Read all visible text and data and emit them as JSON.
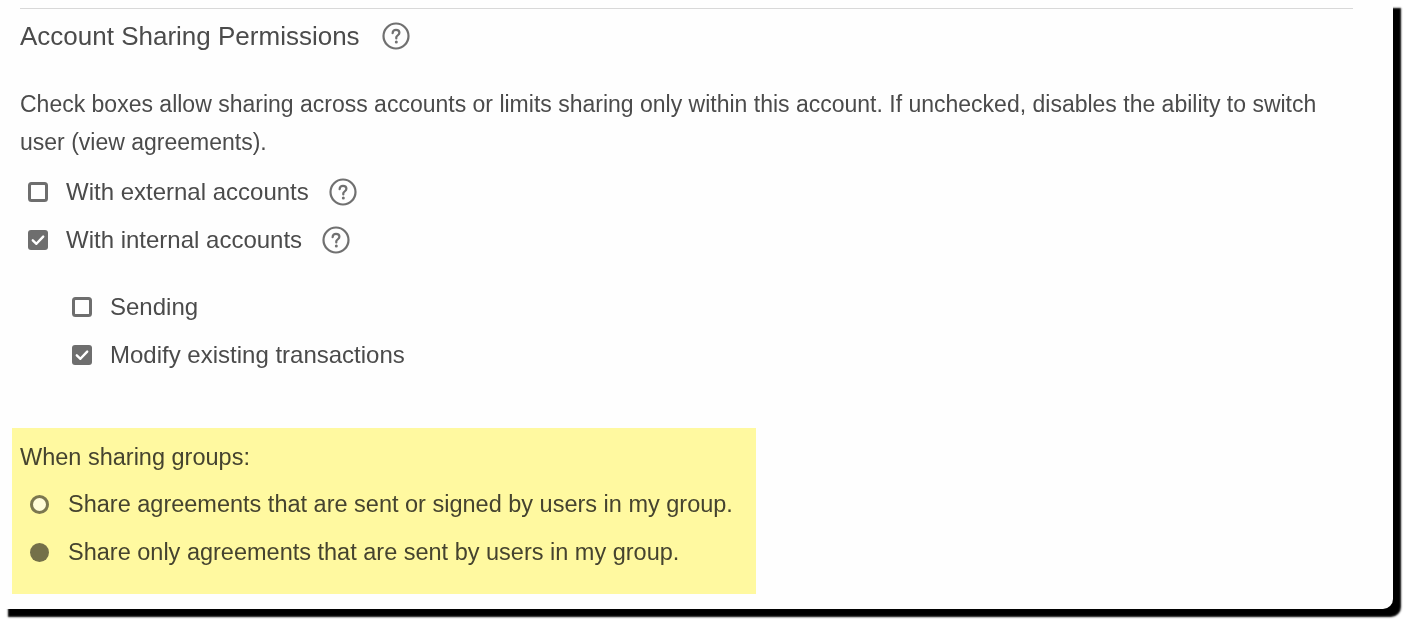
{
  "section": {
    "title": "Account Sharing Permissions",
    "help": true,
    "description": "Check boxes allow sharing across accounts or limits sharing only within this account. If unchecked, disables the ability to switch user (view agreements).",
    "options": [
      {
        "label": "With external accounts",
        "checked": false,
        "help": true
      },
      {
        "label": "With internal accounts",
        "checked": true,
        "help": true,
        "children": [
          {
            "label": "Sending",
            "checked": false
          },
          {
            "label": "Modify existing transactions",
            "checked": true
          }
        ]
      }
    ]
  },
  "group_sharing": {
    "heading": "When sharing groups:",
    "choices": [
      {
        "label": "Share agreements that are sent or signed by users in my group.",
        "selected": false
      },
      {
        "label": "Share only agreements that are sent by users in my group.",
        "selected": true
      }
    ]
  }
}
